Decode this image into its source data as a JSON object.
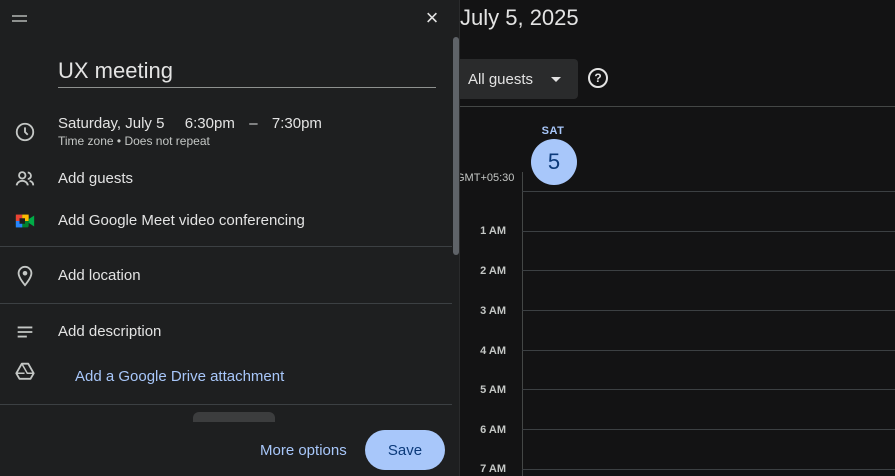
{
  "calendar": {
    "date_heading": "July 5, 2025",
    "guest_filter": "All guests",
    "help_label": "?",
    "day_of_week": "SAT",
    "day_number": "5",
    "timezone": "GMT+05:30",
    "hours": [
      "1 AM",
      "2 AM",
      "3 AM",
      "4 AM",
      "5 AM",
      "6 AM",
      "7 AM"
    ]
  },
  "dialog": {
    "close_label": "×",
    "title_value": "UX meeting",
    "datetime": {
      "date": "Saturday, July 5",
      "start": "6:30pm",
      "dash": "–",
      "end": "7:30pm",
      "sub": "Time zone • Does not repeat"
    },
    "add_guests": "Add guests",
    "meet": "Add Google Meet video conferencing",
    "location": "Add location",
    "description": "Add description",
    "drive": "Add a Google Drive attachment",
    "more_options": "More options",
    "save": "Save"
  },
  "colors": {
    "accent": "#a8c7fa",
    "panel_bg": "#1e1f20",
    "page_bg": "#131314"
  },
  "icons": [
    "drag-handle-icon",
    "close-icon",
    "clock-icon",
    "people-icon",
    "google-meet-icon",
    "location-pin-icon",
    "description-lines-icon",
    "drive-icon",
    "chevron-down-icon",
    "help-icon"
  ]
}
